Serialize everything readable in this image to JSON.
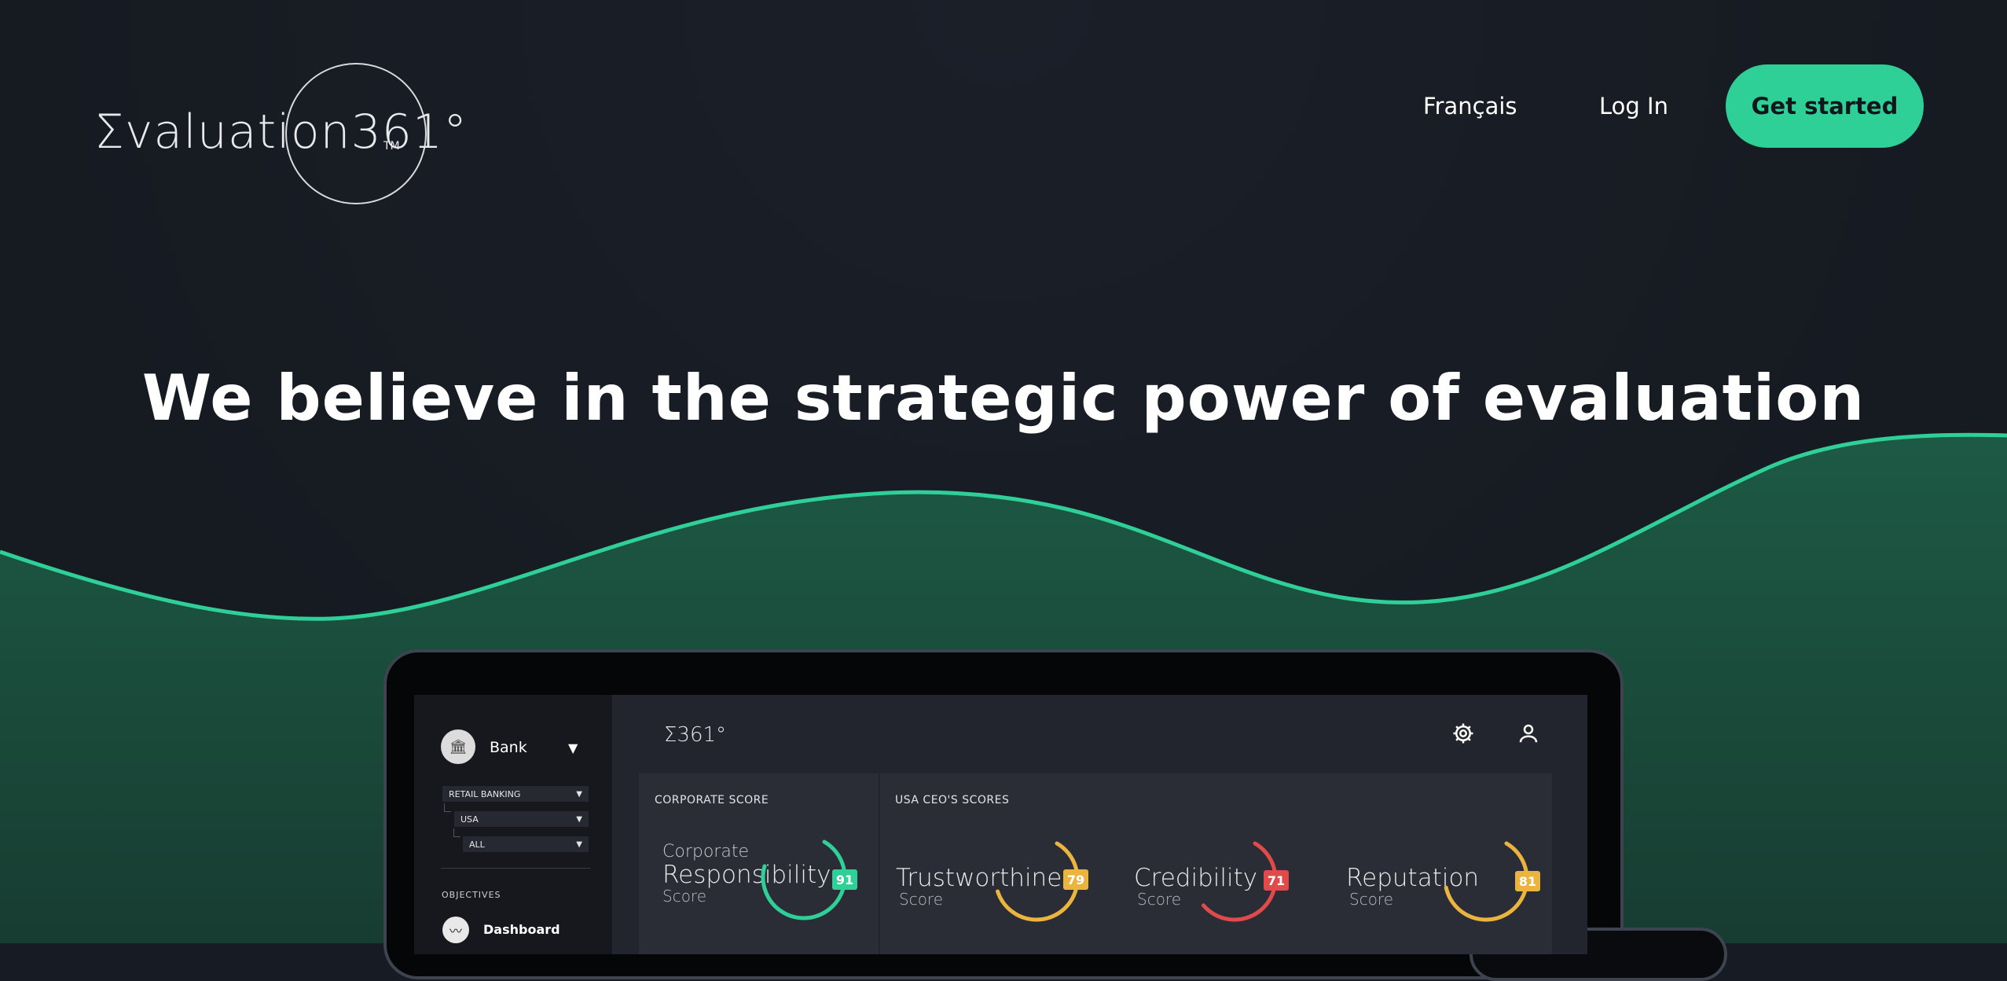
{
  "header": {
    "logo_text": "Σvaluation361°",
    "logo_tm": "TM",
    "nav": {
      "language": "Français",
      "login": "Log In",
      "cta": "Get started"
    }
  },
  "hero": {
    "title": "We believe in the strategic power of evaluation"
  },
  "colors": {
    "accent": "#2fcf98",
    "yellow": "#eab43f",
    "red": "#e04a4a",
    "bg": "#171b23"
  },
  "app": {
    "logo": "Σ361°",
    "sidebar": {
      "entity": "Bank",
      "filters": [
        "RETAIL BANKING",
        "USA",
        "ALL"
      ],
      "section_label": "OBJECTIVES",
      "items": [
        {
          "label": "Dashboard",
          "icon": "line-chart-icon"
        }
      ]
    },
    "toolbar_icons": [
      "gear-icon",
      "user-icon"
    ],
    "corporate": {
      "label": "CORPORATE SCORE",
      "score": {
        "prefix": "Corporate",
        "name": "Responsibility",
        "suffix": "Score",
        "value": "91",
        "color": "#2fcf98"
      }
    },
    "ceo": {
      "label": "USA CEO'S SCORES",
      "scores": [
        {
          "name": "Trustworthiness",
          "suffix": "Score",
          "value": "79",
          "color": "#eab43f"
        },
        {
          "name": "Credibility",
          "suffix": "Score",
          "value": "71",
          "color": "#e04a4a"
        },
        {
          "name": "Reputation",
          "suffix": "Score",
          "value": "81",
          "color": "#eab43f"
        }
      ]
    }
  }
}
